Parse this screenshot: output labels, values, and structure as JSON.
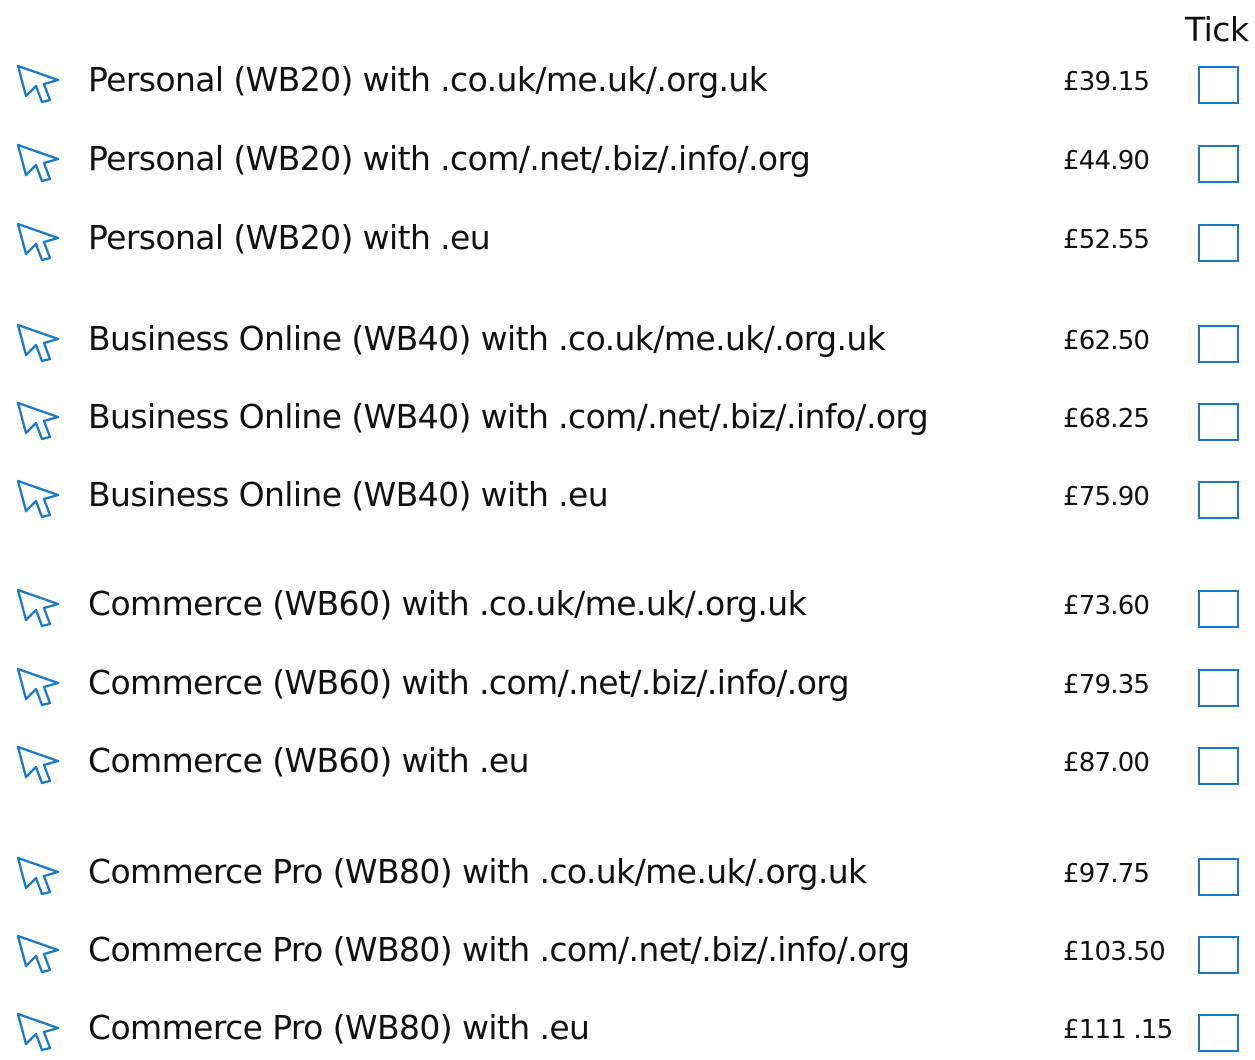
{
  "header": {
    "tick_label": "Tick"
  },
  "colors": {
    "accent": "#1b78c2"
  },
  "rows": [
    {
      "label": "Personal (WB20) with .co.uk/me.uk/.org.uk",
      "price": "£39.15"
    },
    {
      "label": "Personal (WB20) with .com/.net/.biz/.info/.org",
      "price": "£44.90"
    },
    {
      "label": "Personal (WB20) with .eu",
      "price": "£52.55"
    },
    {
      "label": "Business Online (WB40) with .co.uk/me.uk/.org.uk",
      "price": "£62.50"
    },
    {
      "label": "Business Online (WB40) with .com/.net/.biz/.info/.org",
      "price": "£68.25"
    },
    {
      "label": "Business Online (WB40) with .eu",
      "price": "£75.90"
    },
    {
      "label": "Commerce (WB60) with .co.uk/me.uk/.org.uk",
      "price": "£73.60"
    },
    {
      "label": "Commerce (WB60) with .com/.net/.biz/.info/.org",
      "price": "£79.35"
    },
    {
      "label": "Commerce (WB60) with .eu",
      "price": "£87.00"
    },
    {
      "label": "Commerce Pro (WB80) with .co.uk/me.uk/.org.uk",
      "price": "£97.75"
    },
    {
      "label": "Commerce Pro (WB80) with .com/.net/.biz/.info/.org",
      "price": "£103.50"
    },
    {
      "label": "Commerce Pro (WB80) with .eu",
      "price": "£111 .15"
    }
  ]
}
